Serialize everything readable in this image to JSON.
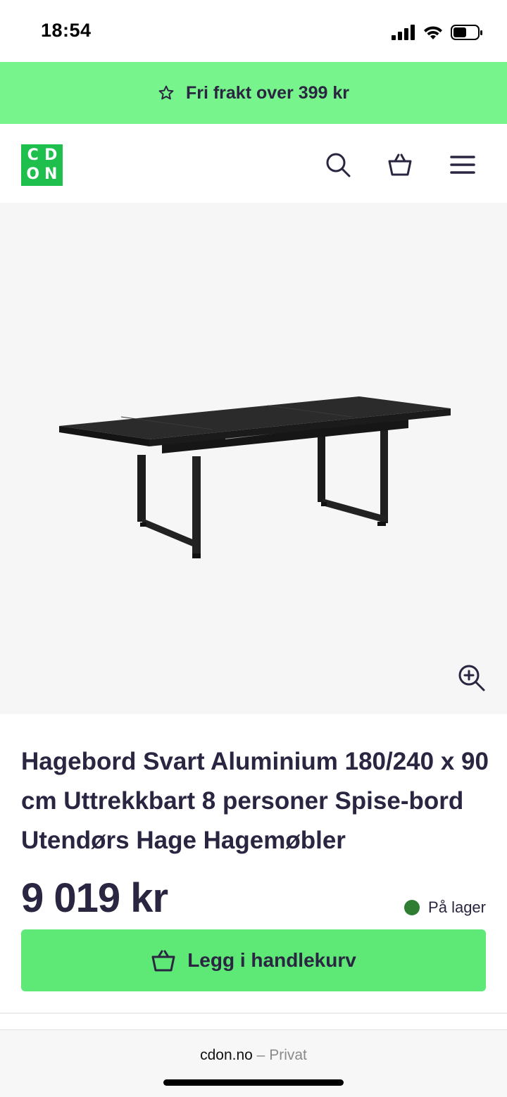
{
  "status_bar": {
    "time": "18:54",
    "icons": [
      "signal-icon",
      "wifi-icon",
      "battery-icon"
    ]
  },
  "promo": {
    "icon": "star-icon",
    "text": "Fri frakt over 399 kr",
    "background": "#78f48c"
  },
  "header": {
    "logo_letters": [
      "C",
      "D",
      "O",
      "N"
    ],
    "logo_color": "#1fbf4d",
    "icons": [
      "search-icon",
      "basket-icon",
      "menu-icon"
    ]
  },
  "product": {
    "title": "Hagebord Svart Aluminium 180/240 x 90 cm Uttrekkbart 8 personer Spise-bord Utendørs Hage Hagemøbler",
    "price": "9 019 kr",
    "stock_status": "På lager",
    "stock_color": "#2e7d32",
    "add_to_cart_label": "Legg i handlekurv",
    "image_alt": "Black aluminium extendable garden table"
  },
  "browser": {
    "domain": "cdon.no",
    "separator": " – ",
    "mode": "Privat"
  }
}
